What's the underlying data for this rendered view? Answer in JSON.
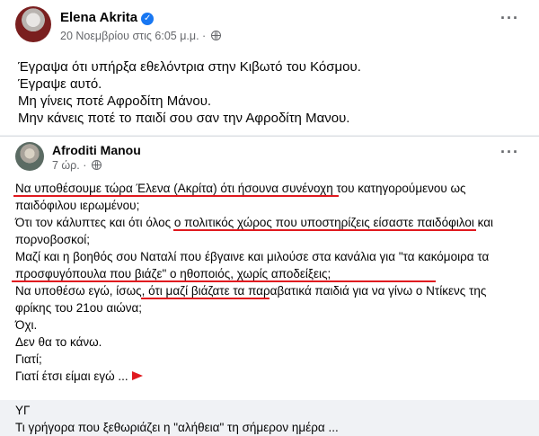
{
  "post1": {
    "author": "Elena Akrita",
    "verified_mark": "✓",
    "timestamp": "20 Νοεμβρίου στις 6:05 μ.μ.",
    "separator": "·",
    "more": "···",
    "lines": [
      "Έγραψα ότι υπήρξα εθελόντρια στην Κιβωτό του Κόσμου.",
      "Έγραψε αυτό.",
      "Μη γίνεις ποτέ Αφροδίτη Μάνου.",
      "Μην κάνεις ποτέ το παιδί σου σαν την Αφροδίτη Μανου."
    ]
  },
  "post2": {
    "author": "Afroditi Manou",
    "timestamp": "7 ώρ.",
    "separator": "·",
    "more": "···",
    "lines": [
      "Να υποθέσουμε τώρα Έλενα (Ακρίτα) ότι ήσουνα συνένοχη του κατηγορούμενου ως",
      "παιδόφιλου ιερωμένου;",
      "Ότι τον κάλυπτες και ότι όλος ο πολιτικός χώρος που υποστηρίζεις είσαστε παιδόφιλοι και",
      "πορνοβοσκοί;",
      "Μαζί και η βοηθός σου Ναταλί που έβγαινε και μιλούσε στα κανάλια για \"τα κακόμοιρα τα",
      "προσφυγόπουλα που βιάζε\" ο ηθοποιός, χωρίς αποδείξεις;",
      "Να υποθέσω εγώ, ίσως, ότι μαζί βιάζατε τα παραβατικά παιδιά για να γίνω ο Ντίκενς της",
      "φρίκης του 21ου αιώνα;",
      "Όχι.",
      "Δεν θα το κάνω.",
      "Γιατί;",
      "Γιατί έτσι είμαι εγώ ...",
      "",
      "ΥΓ",
      "Τι γρήγορα που ξεθωριάζει η \"αλήθεια\" τη σήμερον ημέρα ..."
    ]
  },
  "colors": {
    "underline": "#e0191f",
    "verified": "#1877f2",
    "meta": "#65676b"
  }
}
